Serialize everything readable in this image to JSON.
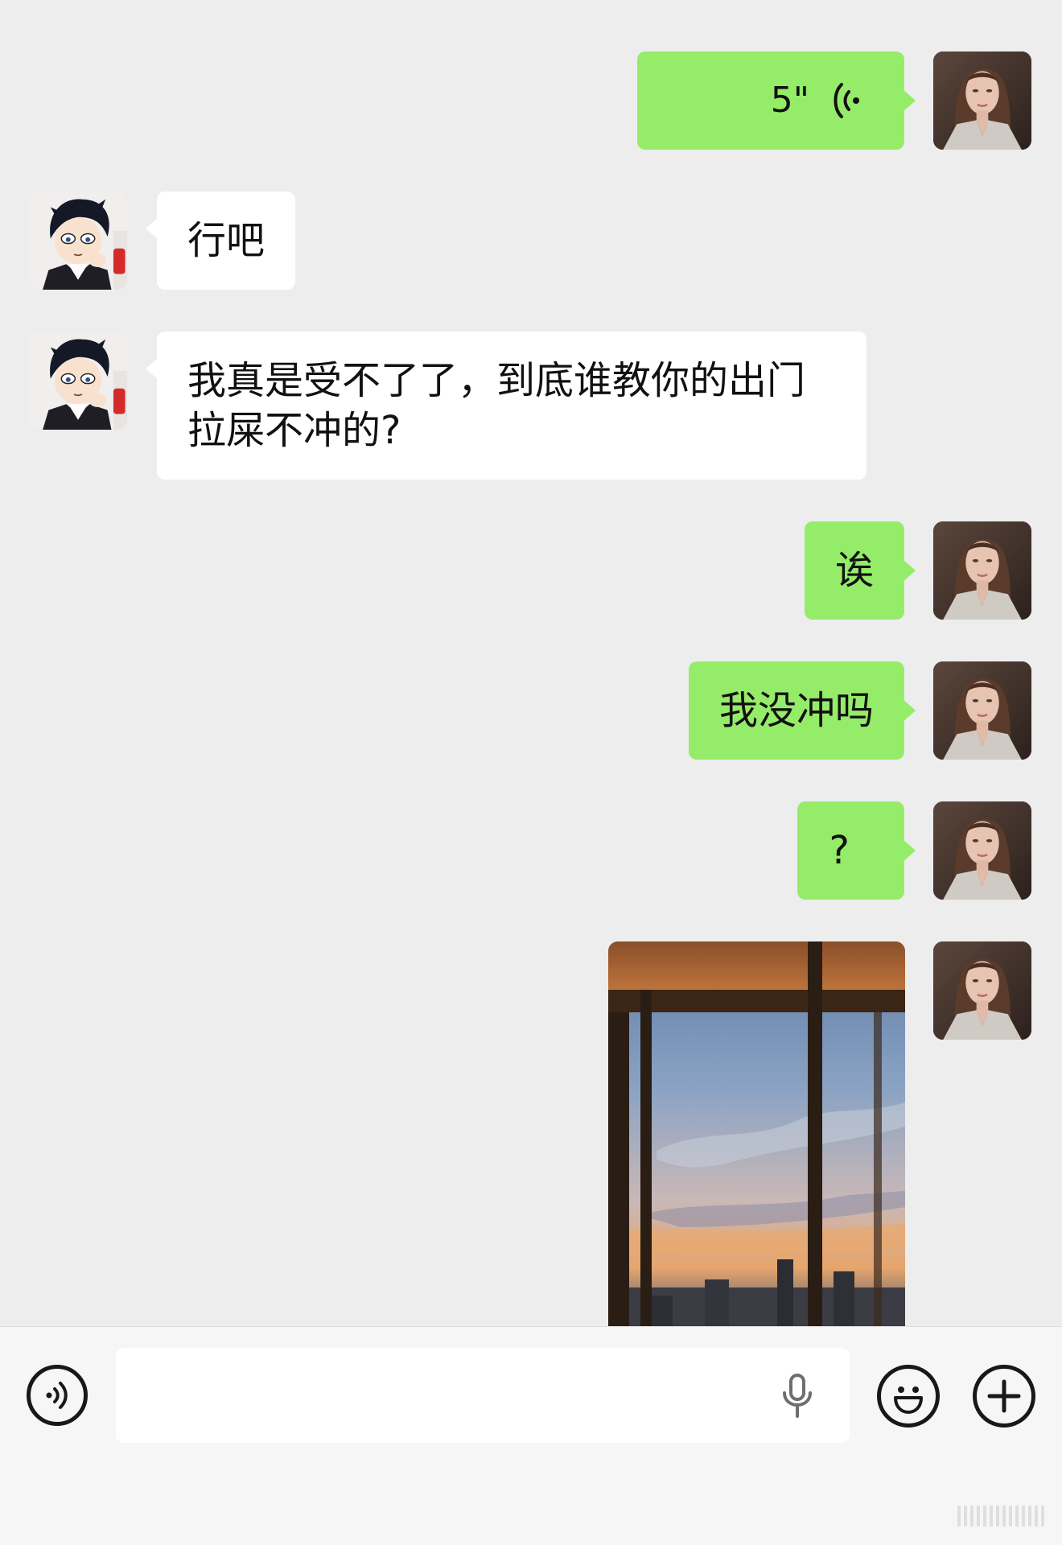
{
  "messages": [
    {
      "id": 1,
      "sender": "me",
      "type": "voice",
      "duration": "5\"",
      "icon": "voice-wave-icon"
    },
    {
      "id": 2,
      "sender": "them",
      "type": "text",
      "text": "行吧"
    },
    {
      "id": 3,
      "sender": "them",
      "type": "text",
      "lines": [
        "我真是受不了了，到底谁教你的出门",
        "拉屎不冲的?"
      ]
    },
    {
      "id": 4,
      "sender": "me",
      "type": "text",
      "text": "诶"
    },
    {
      "id": 5,
      "sender": "me",
      "type": "text",
      "text": "我没冲吗"
    },
    {
      "id": 6,
      "sender": "me",
      "type": "text",
      "text": "?"
    },
    {
      "id": 7,
      "sender": "me",
      "type": "image",
      "subject": "sunset city view through window"
    }
  ],
  "avatars": {
    "me": "woman-portrait-avatar",
    "them": "cartoon-boy-avatar"
  },
  "input_bar": {
    "voice_toggle_icon": "voice-mode-icon",
    "input_value": "",
    "mic_icon": "microphone-icon",
    "emoji_icon": "emoji-icon",
    "plus_icon": "plus-icon"
  },
  "colors": {
    "background": "#ededed",
    "my_bubble": "#95ec69",
    "their_bubble": "#ffffff",
    "bottom_bar": "#f6f6f6"
  }
}
